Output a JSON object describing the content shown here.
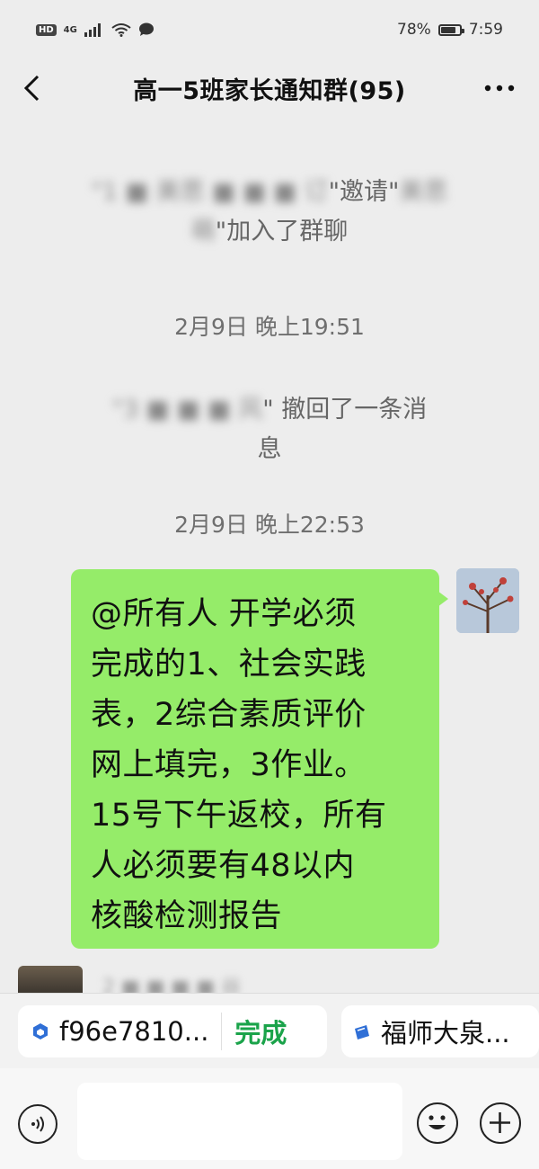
{
  "status_bar": {
    "hd": "HD",
    "network": "4G",
    "battery_text": "78%",
    "battery_level": 0.78,
    "time": "7:59"
  },
  "header": {
    "title": "高一5班家长通知群(95)"
  },
  "system_messages": [
    {
      "redacted_lead": "\"1 ■ 美思 ■ ■ ■ 订",
      "visible_text": "\"邀请\"",
      "redacted_mid": "美思",
      "line2_redacted": "萌",
      "line2_text": "\"加入了群聊"
    },
    {
      "redacted_lead": "\"3 ■ ■ ■ 风",
      "visible_text": "\" 撤回了一条消",
      "line2_text": "息"
    }
  ],
  "timestamps": [
    "2月9日 晚上19:51",
    "2月9日 晚上22:53"
  ],
  "message": {
    "lines": [
      "@所有人  开学必须",
      "完成的1、社会实践",
      "表，2综合素质评价",
      "网上填完，3作业。",
      "15号下午返校，所有",
      "人必须要有48以内",
      "核酸检测报告"
    ]
  },
  "next_message": {
    "redacted_name": "2 ■ ■ ■ ■ 谷"
  },
  "link_bar": {
    "chip1_text": "f96e7810...",
    "chip1_status": "完成",
    "chip2_text": "福师大泉...",
    "colors": {
      "done": "#1aa34a",
      "icon1": "#2f6fd6",
      "icon2": "#2f6fd6"
    }
  },
  "input_bar": {
    "placeholder": ""
  },
  "colors": {
    "bubble": "#95ec69",
    "background": "#ededed"
  }
}
